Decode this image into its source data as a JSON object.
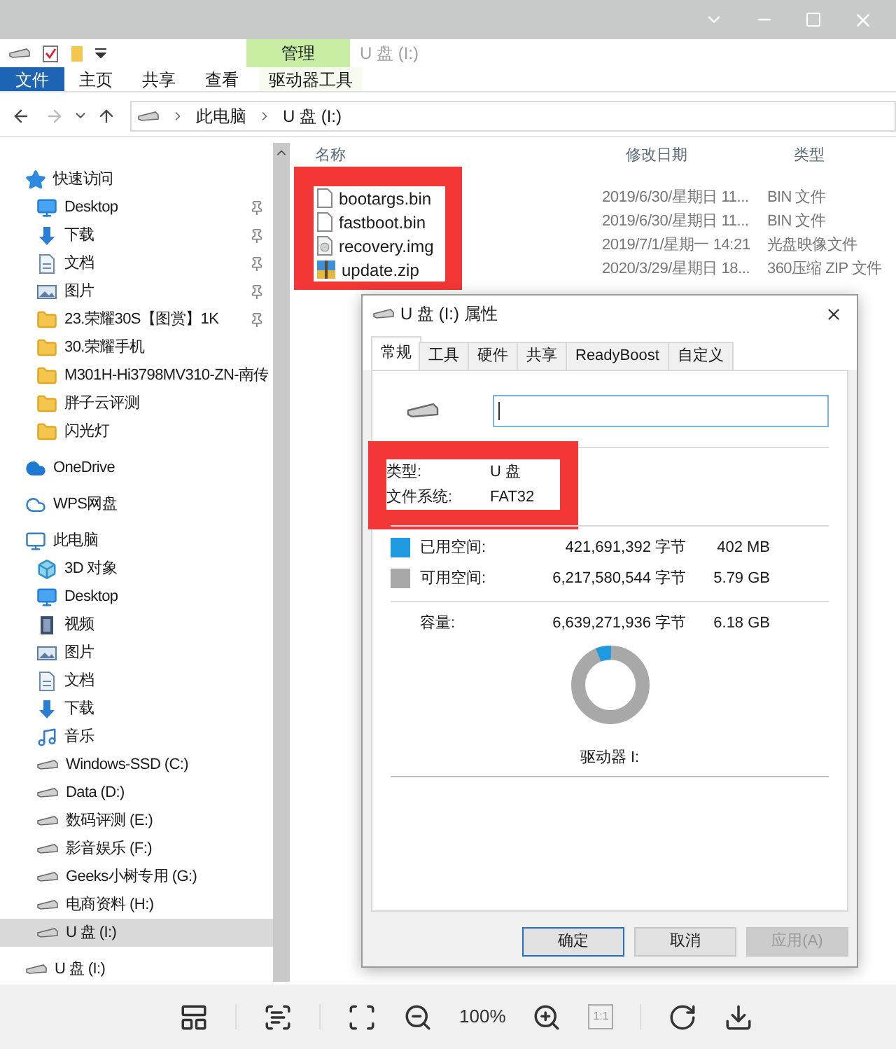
{
  "window": {
    "title": "U 盘 (I:)"
  },
  "ribbon": {
    "context_group": "管理",
    "tabs": [
      {
        "label": "文件",
        "kind": "file"
      },
      {
        "label": "主页",
        "kind": "plain"
      },
      {
        "label": "共享",
        "kind": "plain"
      },
      {
        "label": "查看",
        "kind": "plain"
      },
      {
        "label": "驱动器工具",
        "kind": "context"
      }
    ]
  },
  "address": {
    "path": [
      "此电脑",
      "U 盘 (I:)"
    ]
  },
  "nav": {
    "items": [
      {
        "label": "快速访问",
        "kind": "star",
        "selected": false,
        "children": [
          {
            "label": "Desktop",
            "kind": "desktop",
            "selected": false,
            "pinned": true
          },
          {
            "label": "下载",
            "kind": "download",
            "selected": false,
            "pinned": true
          },
          {
            "label": "文档",
            "kind": "doc",
            "selected": false,
            "pinned": true
          },
          {
            "label": "图片",
            "kind": "pictures",
            "selected": false,
            "pinned": true
          },
          {
            "label": "23.荣耀30S【图赏】1K",
            "kind": "folder",
            "selected": false,
            "pinned": true
          },
          {
            "label": "30.荣耀手机",
            "kind": "folder",
            "selected": false,
            "pinned": false
          },
          {
            "label": "M301H-Hi3798MV310-ZN-南传",
            "kind": "folder",
            "selected": false,
            "pinned": false
          },
          {
            "label": "胖子云评测",
            "kind": "folder",
            "selected": false,
            "pinned": false
          },
          {
            "label": "闪光灯",
            "kind": "folder",
            "selected": false,
            "pinned": false
          }
        ]
      },
      {
        "label": "OneDrive",
        "kind": "cloud",
        "selected": false
      },
      {
        "label": "WPS网盘",
        "kind": "cloud-outline",
        "selected": false
      },
      {
        "label": "此电脑",
        "kind": "pc",
        "selected": false,
        "children": [
          {
            "label": "3D 对象",
            "kind": "cube",
            "selected": false
          },
          {
            "label": "Desktop",
            "kind": "desktop",
            "selected": false
          },
          {
            "label": "视频",
            "kind": "video",
            "selected": false
          },
          {
            "label": "图片",
            "kind": "pictures",
            "selected": false
          },
          {
            "label": "文档",
            "kind": "doc",
            "selected": false
          },
          {
            "label": "下载",
            "kind": "download",
            "selected": false
          },
          {
            "label": "音乐",
            "kind": "music",
            "selected": false
          },
          {
            "label": "Windows-SSD (C:)",
            "kind": "system-drive",
            "selected": false
          },
          {
            "label": "Data (D:)",
            "kind": "drive",
            "selected": false
          },
          {
            "label": "数码评测 (E:)",
            "kind": "drive",
            "selected": false
          },
          {
            "label": "影音娱乐 (F:)",
            "kind": "drive",
            "selected": false
          },
          {
            "label": "Geeks小树专用 (G:)",
            "kind": "drive",
            "selected": false
          },
          {
            "label": "电商资料 (H:)",
            "kind": "drive",
            "selected": false
          },
          {
            "label": "U 盘 (I:)",
            "kind": "drive",
            "selected": true
          }
        ]
      },
      {
        "label": "U 盘 (I:)",
        "kind": "drive",
        "selected": false
      }
    ]
  },
  "files": {
    "columns": [
      "名称",
      "修改日期",
      "类型"
    ],
    "rows": [
      {
        "name": "bootargs.bin",
        "date": "2019/6/30/星期日 11...",
        "type": "BIN 文件",
        "kind": "file"
      },
      {
        "name": "fastboot.bin",
        "date": "2019/6/30/星期日 11...",
        "type": "BIN 文件",
        "kind": "file"
      },
      {
        "name": "recovery.img",
        "date": "2019/7/1/星期一 14:21",
        "type": "光盘映像文件",
        "kind": "image"
      },
      {
        "name": "update.zip",
        "date": "2020/3/29/星期日 18...",
        "type": "360压缩 ZIP 文件",
        "kind": "zip"
      }
    ]
  },
  "dialog": {
    "title": "U 盘 (I:) 属性",
    "tabs": [
      {
        "label": "常规",
        "selected": true
      },
      {
        "label": "工具",
        "selected": false
      },
      {
        "label": "硬件",
        "selected": false
      },
      {
        "label": "共享",
        "selected": false
      },
      {
        "label": "ReadyBoost",
        "selected": false
      },
      {
        "label": "自定义",
        "selected": false
      }
    ],
    "info": [
      {
        "label": "类型:",
        "value": "U 盘"
      },
      {
        "label": "文件系统:",
        "value": "FAT32"
      }
    ],
    "space": [
      {
        "label": "已用空间:",
        "bytes": "421,691,392 字节",
        "size": "402 MB",
        "color": "#1e9be0"
      },
      {
        "label": "可用空间:",
        "bytes": "6,217,580,544 字节",
        "size": "5.79 GB",
        "color": "#a8a8a8"
      }
    ],
    "capacity": {
      "label": "容量:",
      "bytes": "6,639,271,936 字节",
      "size": "6.18 GB"
    },
    "drive_label": "驱动器 I:",
    "buttons": [
      {
        "label": "确定",
        "kind": "default",
        "disabled": false
      },
      {
        "label": "取消",
        "kind": "plain",
        "disabled": false
      },
      {
        "label": "应用(A)",
        "kind": "plain",
        "disabled": true
      }
    ]
  },
  "viewer": {
    "zoom": "100%",
    "ratio": "1:1"
  }
}
